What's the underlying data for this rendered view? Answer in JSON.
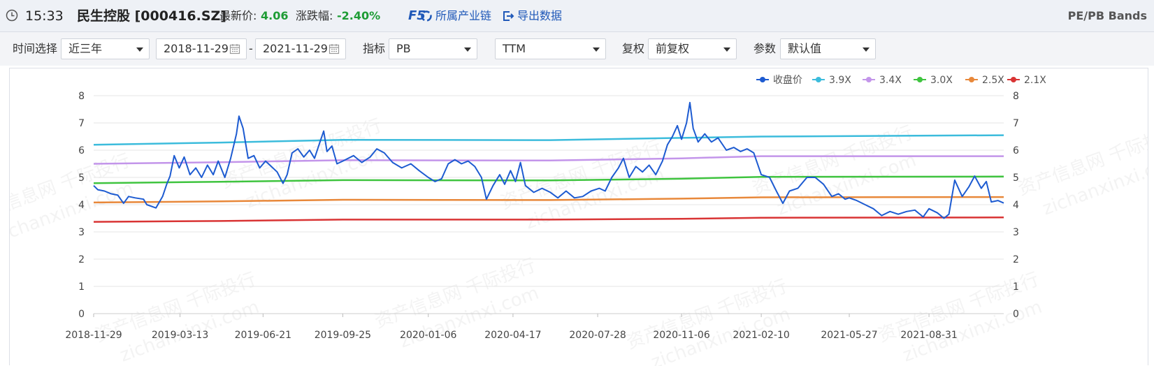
{
  "header": {
    "time": "15:33",
    "stock_name": "民生控股 [000416.SZ]",
    "price_label": "最新价:",
    "price_value": "4.06",
    "change_label": "涨跌幅:",
    "change_value": "-2.40%",
    "f5_label": "F5",
    "chain_link": "所属产业链",
    "export_link": "导出数据",
    "right_title": "PE/PB Bands"
  },
  "toolbar": {
    "time_select_label": "时间选择",
    "time_select_value": "近三年",
    "start_date": "2018-11-29",
    "date_separator": "-",
    "end_date": "2021-11-29",
    "indicator_label": "指标",
    "indicator_value": "PB",
    "ttm_value": "TTM",
    "fq_label": "复权",
    "fq_value": "前复权",
    "param_label": "参数",
    "param_value": "默认值"
  },
  "watermark": {
    "cn": "资产信息网 千际投行",
    "en": "zichanxinxi.com"
  },
  "colors": {
    "price": "#1d5bd1",
    "b39": "#3cbcdc",
    "b34": "#c395ea",
    "b30": "#3fc43f",
    "b25": "#e8883a",
    "b21": "#d93434"
  },
  "chart_data": {
    "type": "line",
    "x_ticks": [
      "2018-11-29",
      "2019-03-13",
      "2019-06-21",
      "2019-09-25",
      "2020-01-06",
      "2020-04-17",
      "2020-07-28",
      "2020-11-06",
      "2021-02-10",
      "2021-05-27",
      "2021-08-31"
    ],
    "ylim": [
      0,
      8
    ],
    "y_ticks": [
      0,
      1,
      2,
      3,
      4,
      5,
      6,
      7,
      8
    ],
    "grid": true,
    "legend_position": "top-right",
    "x_range": [
      "2018-11-29",
      "2021-11-29"
    ],
    "series": [
      {
        "name": "收盘价",
        "color": "#1d5bd1",
        "points": [
          [
            "2018-11-29",
            4.7
          ],
          [
            "2018-12-04",
            4.55
          ],
          [
            "2018-12-12",
            4.5
          ],
          [
            "2018-12-20",
            4.4
          ],
          [
            "2018-12-28",
            4.35
          ],
          [
            "2019-01-04",
            4.05
          ],
          [
            "2019-01-10",
            4.3
          ],
          [
            "2019-01-18",
            4.25
          ],
          [
            "2019-01-28",
            4.2
          ],
          [
            "2019-02-01",
            4.0
          ],
          [
            "2019-02-12",
            3.88
          ],
          [
            "2019-02-20",
            4.3
          ],
          [
            "2019-02-25",
            4.75
          ],
          [
            "2019-03-01",
            5.05
          ],
          [
            "2019-03-06",
            5.8
          ],
          [
            "2019-03-12",
            5.35
          ],
          [
            "2019-03-18",
            5.75
          ],
          [
            "2019-03-25",
            5.1
          ],
          [
            "2019-04-01",
            5.35
          ],
          [
            "2019-04-08",
            5.0
          ],
          [
            "2019-04-15",
            5.45
          ],
          [
            "2019-04-22",
            5.1
          ],
          [
            "2019-04-28",
            5.6
          ],
          [
            "2019-05-06",
            5.0
          ],
          [
            "2019-05-13",
            5.7
          ],
          [
            "2019-05-20",
            6.6
          ],
          [
            "2019-05-23",
            7.25
          ],
          [
            "2019-05-28",
            6.8
          ],
          [
            "2019-06-03",
            5.7
          ],
          [
            "2019-06-10",
            5.8
          ],
          [
            "2019-06-17",
            5.35
          ],
          [
            "2019-06-24",
            5.6
          ],
          [
            "2019-07-01",
            5.4
          ],
          [
            "2019-07-08",
            5.2
          ],
          [
            "2019-07-15",
            4.78
          ],
          [
            "2019-07-20",
            5.1
          ],
          [
            "2019-07-26",
            5.9
          ],
          [
            "2019-08-02",
            6.05
          ],
          [
            "2019-08-09",
            5.75
          ],
          [
            "2019-08-16",
            6.0
          ],
          [
            "2019-08-22",
            5.7
          ],
          [
            "2019-08-28",
            6.25
          ],
          [
            "2019-09-02",
            6.7
          ],
          [
            "2019-09-06",
            5.95
          ],
          [
            "2019-09-12",
            6.15
          ],
          [
            "2019-09-18",
            5.5
          ],
          [
            "2019-09-25",
            5.6
          ],
          [
            "2019-10-08",
            5.8
          ],
          [
            "2019-10-18",
            5.55
          ],
          [
            "2019-10-28",
            5.75
          ],
          [
            "2019-11-05",
            6.05
          ],
          [
            "2019-11-14",
            5.9
          ],
          [
            "2019-11-24",
            5.55
          ],
          [
            "2019-12-05",
            5.35
          ],
          [
            "2019-12-16",
            5.5
          ],
          [
            "2019-12-26",
            5.25
          ],
          [
            "2020-01-06",
            5.0
          ],
          [
            "2020-01-14",
            4.85
          ],
          [
            "2020-01-22",
            4.95
          ],
          [
            "2020-01-30",
            5.5
          ],
          [
            "2020-02-07",
            5.65
          ],
          [
            "2020-02-15",
            5.5
          ],
          [
            "2020-02-23",
            5.6
          ],
          [
            "2020-03-02",
            5.4
          ],
          [
            "2020-03-10",
            5.0
          ],
          [
            "2020-03-16",
            4.2
          ],
          [
            "2020-03-24",
            4.7
          ],
          [
            "2020-04-01",
            5.1
          ],
          [
            "2020-04-07",
            4.75
          ],
          [
            "2020-04-14",
            5.25
          ],
          [
            "2020-04-20",
            4.85
          ],
          [
            "2020-04-26",
            5.55
          ],
          [
            "2020-05-02",
            4.7
          ],
          [
            "2020-05-12",
            4.45
          ],
          [
            "2020-05-22",
            4.6
          ],
          [
            "2020-06-01",
            4.45
          ],
          [
            "2020-06-10",
            4.25
          ],
          [
            "2020-06-20",
            4.5
          ],
          [
            "2020-06-30",
            4.25
          ],
          [
            "2020-07-10",
            4.3
          ],
          [
            "2020-07-20",
            4.5
          ],
          [
            "2020-07-30",
            4.6
          ],
          [
            "2020-08-06",
            4.5
          ],
          [
            "2020-08-14",
            5.0
          ],
          [
            "2020-08-22",
            5.35
          ],
          [
            "2020-08-28",
            5.7
          ],
          [
            "2020-09-04",
            5.0
          ],
          [
            "2020-09-12",
            5.4
          ],
          [
            "2020-09-20",
            5.2
          ],
          [
            "2020-09-28",
            5.45
          ],
          [
            "2020-10-06",
            5.1
          ],
          [
            "2020-10-14",
            5.6
          ],
          [
            "2020-10-20",
            6.2
          ],
          [
            "2020-10-26",
            6.5
          ],
          [
            "2020-11-01",
            6.9
          ],
          [
            "2020-11-06",
            6.4
          ],
          [
            "2020-11-12",
            7.0
          ],
          [
            "2020-11-16",
            7.75
          ],
          [
            "2020-11-20",
            6.8
          ],
          [
            "2020-11-26",
            6.3
          ],
          [
            "2020-12-04",
            6.6
          ],
          [
            "2020-12-12",
            6.3
          ],
          [
            "2020-12-20",
            6.45
          ],
          [
            "2020-12-30",
            6.0
          ],
          [
            "2021-01-08",
            6.1
          ],
          [
            "2021-01-16",
            5.95
          ],
          [
            "2021-01-24",
            6.05
          ],
          [
            "2021-02-01",
            5.9
          ],
          [
            "2021-02-10",
            5.1
          ],
          [
            "2021-02-20",
            5.0
          ],
          [
            "2021-03-01",
            4.45
          ],
          [
            "2021-03-08",
            4.05
          ],
          [
            "2021-03-16",
            4.5
          ],
          [
            "2021-03-26",
            4.6
          ],
          [
            "2021-04-06",
            5.0
          ],
          [
            "2021-04-16",
            5.0
          ],
          [
            "2021-04-26",
            4.75
          ],
          [
            "2021-05-06",
            4.3
          ],
          [
            "2021-05-14",
            4.4
          ],
          [
            "2021-05-22",
            4.2
          ],
          [
            "2021-05-27",
            4.25
          ],
          [
            "2021-06-05",
            4.15
          ],
          [
            "2021-06-15",
            4.0
          ],
          [
            "2021-06-25",
            3.85
          ],
          [
            "2021-07-05",
            3.6
          ],
          [
            "2021-07-15",
            3.75
          ],
          [
            "2021-07-25",
            3.65
          ],
          [
            "2021-08-04",
            3.75
          ],
          [
            "2021-08-14",
            3.8
          ],
          [
            "2021-08-24",
            3.55
          ],
          [
            "2021-08-31",
            3.85
          ],
          [
            "2021-09-10",
            3.7
          ],
          [
            "2021-09-18",
            3.5
          ],
          [
            "2021-09-24",
            3.65
          ],
          [
            "2021-10-01",
            4.9
          ],
          [
            "2021-10-10",
            4.3
          ],
          [
            "2021-10-18",
            4.65
          ],
          [
            "2021-10-25",
            5.05
          ],
          [
            "2021-11-02",
            4.6
          ],
          [
            "2021-11-08",
            4.85
          ],
          [
            "2021-11-14",
            4.1
          ],
          [
            "2021-11-22",
            4.15
          ],
          [
            "2021-11-29",
            4.06
          ]
        ]
      },
      {
        "name": "3.9X",
        "color": "#3cbcdc",
        "points": [
          [
            "2018-11-29",
            6.2
          ],
          [
            "2019-05-01",
            6.28
          ],
          [
            "2019-09-25",
            6.38
          ],
          [
            "2020-06-01",
            6.37
          ],
          [
            "2020-11-06",
            6.45
          ],
          [
            "2021-02-10",
            6.5
          ],
          [
            "2021-11-29",
            6.55
          ]
        ]
      },
      {
        "name": "3.4X",
        "color": "#c395ea",
        "points": [
          [
            "2018-11-29",
            5.5
          ],
          [
            "2019-05-01",
            5.56
          ],
          [
            "2019-09-25",
            5.63
          ],
          [
            "2020-06-01",
            5.62
          ],
          [
            "2020-11-06",
            5.7
          ],
          [
            "2021-02-10",
            5.78
          ],
          [
            "2021-11-29",
            5.78
          ]
        ]
      },
      {
        "name": "3.0X",
        "color": "#3fc43f",
        "points": [
          [
            "2018-11-29",
            4.79
          ],
          [
            "2019-05-01",
            4.84
          ],
          [
            "2019-09-25",
            4.9
          ],
          [
            "2020-06-01",
            4.89
          ],
          [
            "2020-11-06",
            4.95
          ],
          [
            "2021-02-10",
            5.02
          ],
          [
            "2021-11-29",
            5.03
          ]
        ]
      },
      {
        "name": "2.5X",
        "color": "#e8883a",
        "points": [
          [
            "2018-11-29",
            4.08
          ],
          [
            "2019-05-01",
            4.12
          ],
          [
            "2019-09-25",
            4.18
          ],
          [
            "2020-06-01",
            4.17
          ],
          [
            "2020-11-06",
            4.22
          ],
          [
            "2021-02-10",
            4.27
          ],
          [
            "2021-11-29",
            4.28
          ]
        ]
      },
      {
        "name": "2.1X",
        "color": "#d93434",
        "points": [
          [
            "2018-11-29",
            3.37
          ],
          [
            "2019-05-01",
            3.4
          ],
          [
            "2019-09-25",
            3.45
          ],
          [
            "2020-06-01",
            3.45
          ],
          [
            "2020-11-06",
            3.48
          ],
          [
            "2021-02-10",
            3.52
          ],
          [
            "2021-11-29",
            3.53
          ]
        ]
      }
    ]
  }
}
